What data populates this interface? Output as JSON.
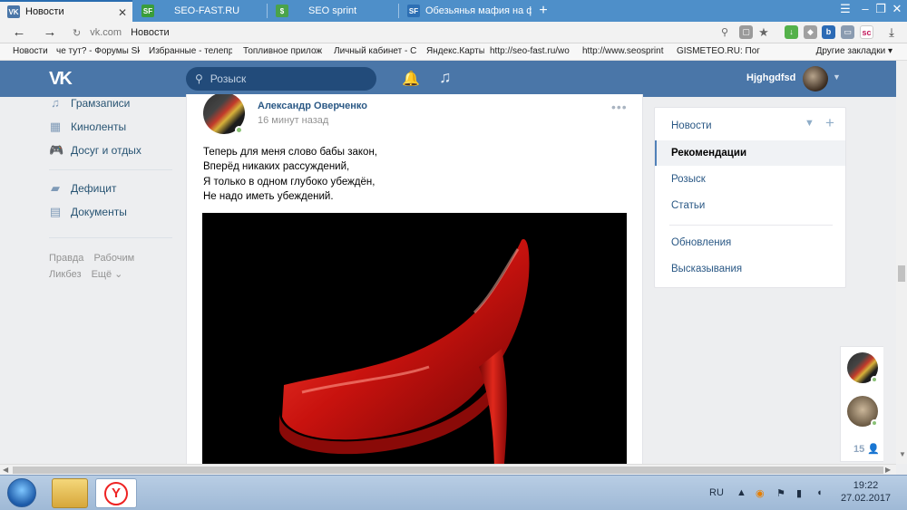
{
  "browser": {
    "tabs": [
      {
        "title": "Новости",
        "active": true,
        "favicon": "vk",
        "color": "#4a76a8"
      },
      {
        "title": "SEO-FAST.RU",
        "active": false,
        "favicon": "SF",
        "color": "#3a9d3a"
      },
      {
        "title": "SEO sprint",
        "active": false,
        "favicon": "$",
        "color": "#4aa34a"
      },
      {
        "title": "Обезьянья мафия на форуме",
        "active": false,
        "favicon": "SF",
        "color": "#2d6fb4"
      }
    ],
    "address": {
      "domain": "vk.com",
      "page_title": "Новости"
    },
    "bookmarks": [
      "Новости",
      "че тут? - Форумы Sk",
      "Избранные - телепр",
      "Топливное прилож",
      "Личный кабинет - С",
      "Яндекс.Карты",
      "http://seo-fast.ru/wo",
      "http://www.seosprint",
      "GISMETEO.RU: Погод"
    ],
    "other_bookmarks": "Другие закладки"
  },
  "vk": {
    "search_placeholder": "Розыск",
    "username": "Hjghgdfsd",
    "left_menu": [
      {
        "label": "Грамзаписи",
        "icon": "music-note-icon"
      },
      {
        "label": "Киноленты",
        "icon": "film-icon"
      },
      {
        "label": "Досуг и отдых",
        "icon": "gamepad-icon"
      },
      {
        "label": "Дефицит",
        "icon": "bag-icon"
      },
      {
        "label": "Документы",
        "icon": "document-icon"
      }
    ],
    "footer_links": {
      "row1": [
        "Правда",
        "Рабочим"
      ],
      "row2": [
        "Ликбез",
        "Ещё"
      ]
    },
    "post": {
      "author": "Александр Оверченко",
      "time": "16 минут назад",
      "lines": [
        "Теперь для меня слово бабы закон,",
        "Вперёд никаких рассуждений,",
        "Я только в одном глубоко убеждён,",
        "Не надо иметь убеждений."
      ]
    },
    "right_menu": {
      "items": [
        {
          "label": "Новости",
          "active": false
        },
        {
          "label": "Рекомендации",
          "active": true
        },
        {
          "label": "Розыск",
          "active": false
        },
        {
          "label": "Статьи",
          "active": false
        },
        {
          "label": "Обновления",
          "active": false
        },
        {
          "label": "Высказывания",
          "active": false
        }
      ]
    },
    "chat_count": "15"
  },
  "taskbar": {
    "lang": "RU",
    "time": "19:22",
    "date": "27.02.2017"
  }
}
